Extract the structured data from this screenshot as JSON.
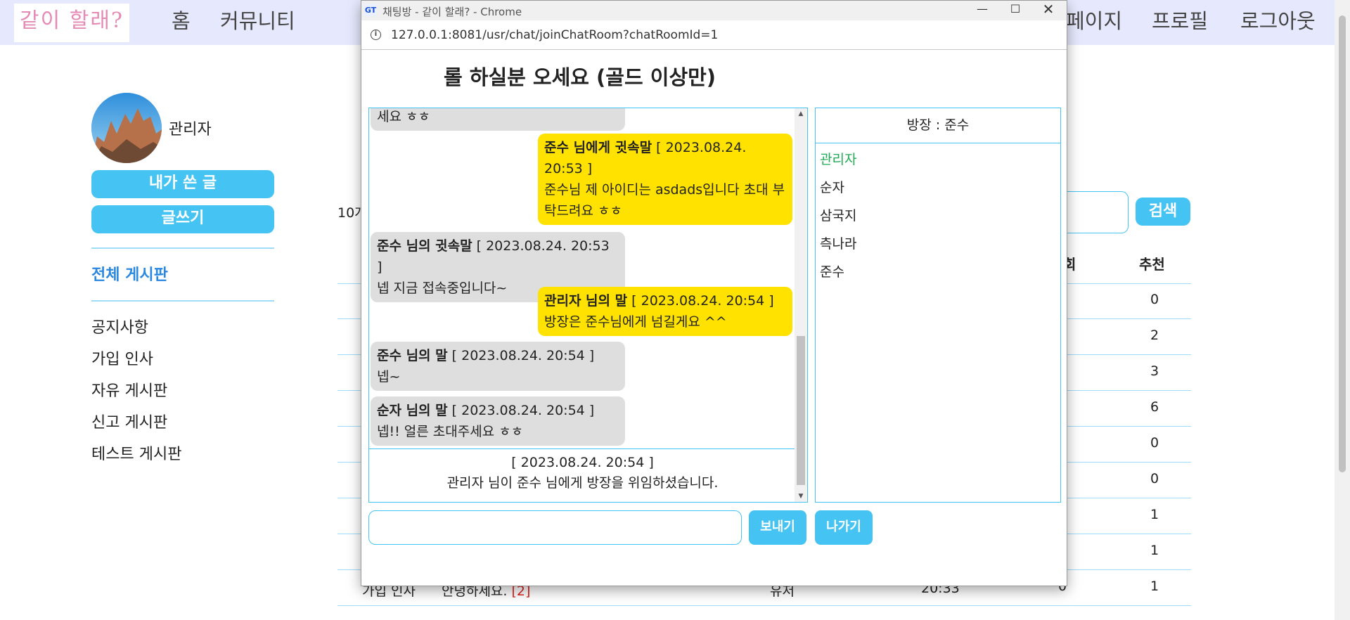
{
  "site": {
    "logo": "같이 할래?",
    "nav": [
      "홈",
      "커뮤니티",
      "페이지",
      "프로필",
      "로그아웃"
    ]
  },
  "sidebar": {
    "profile_name": "관리자",
    "my_posts_btn": "내가 쓴 글",
    "write_btn": "글쓰기",
    "active_board": "전체 게시판",
    "boards": [
      "공지사항",
      "가입 인사",
      "자유 게시판",
      "신고 게시판",
      "테스트 게시판"
    ]
  },
  "list": {
    "count_fragment": "10개",
    "search_placeholder": ".",
    "search_btn": "검색",
    "headers": {
      "views": "회",
      "recommend": "추천"
    },
    "recommend_values": [
      "0",
      "2",
      "3",
      "6",
      "0",
      "0",
      "1",
      "1",
      "1"
    ],
    "view_fragments": [
      "0",
      "0",
      "0"
    ],
    "visible_row": {
      "board": "가입 인사",
      "title": "안녕하세요.",
      "comments": "[2]",
      "writer": "유저",
      "time": "20:33",
      "views": "0",
      "recommend": "1"
    }
  },
  "popup": {
    "window_title": "채팅방 - 같이 할래? - Chrome",
    "url": "127.0.0.1:8081/usr/chat/joinChatRoom?chatRoomId=1",
    "room_title": "롤 하실분 오세요 (골드 이상만)",
    "messages": [
      {
        "type": "other",
        "head": "",
        "meta": "",
        "text": "세요 ㅎㅎ"
      },
      {
        "type": "mine",
        "head": "준수 님에게 귓속말",
        "meta": " [ 2023.08.24. 20:53 ]",
        "text": "준수님 제 아이디는 asdads입니다 초대 부탁드려요 ㅎㅎ"
      },
      {
        "type": "other",
        "head": "준수 님의 귓속말",
        "meta": " [ 2023.08.24. 20:53 ]",
        "text": "넵 지금 접속중입니다~"
      },
      {
        "type": "mine",
        "head": "관리자 님의 말",
        "meta": " [ 2023.08.24. 20:54 ]",
        "text": "방장은 준수님에게 넘길게요 ^^"
      },
      {
        "type": "other",
        "head": "준수 님의 말",
        "meta": " [ 2023.08.24. 20:54 ]",
        "text": "넵~"
      },
      {
        "type": "other",
        "head": "순자 님의 말",
        "meta": " [ 2023.08.24. 20:54 ]",
        "text": "넵!! 얼른 초대주세요 ㅎㅎ"
      }
    ],
    "system_message": {
      "time": "[ 2023.08.24. 20:54 ]",
      "text": "관리자 님이 준수 님에게 방장을 위임하셨습니다."
    },
    "owner_label": "방장 : 준수",
    "users": [
      "관리자",
      "순자",
      "삼국지",
      "측나라",
      "준수"
    ],
    "send_btn": "보내기",
    "leave_btn": "나가기",
    "colors": {
      "accent": "#45c4f4",
      "mine_bubble": "#ffe200",
      "other_bubble": "#dedede",
      "me": "#1faa55"
    }
  }
}
